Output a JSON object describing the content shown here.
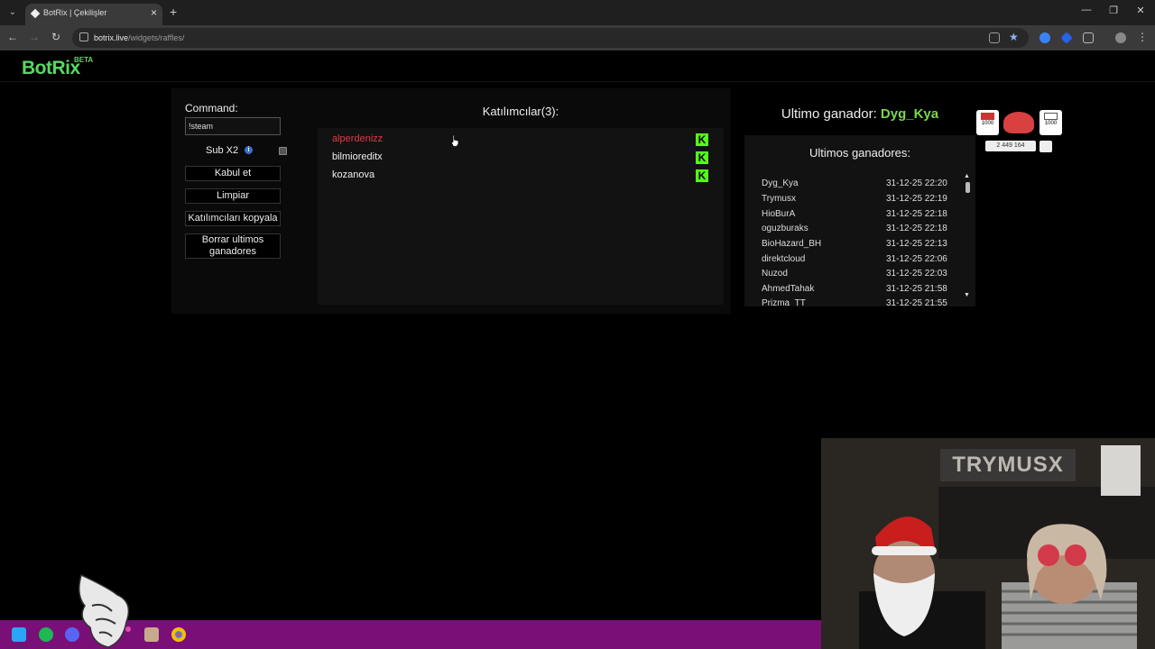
{
  "browser": {
    "tab_title": "BotRix | Çekilişler",
    "url_host": "botrix.live",
    "url_path": "/widgets/raffles/"
  },
  "app": {
    "logo": "BotRix",
    "logo_badge": "BETA"
  },
  "controls": {
    "command_label": "Command:",
    "command_value": "!steam",
    "sub_x2_label": "Sub X2",
    "sub_x2_checked": false,
    "accept_label": "Kabul et",
    "clear_label": "Limpiar",
    "copy_participants_label": "Katılımcıları kopyala",
    "delete_winners_label": "Borrar ultimos ganadores"
  },
  "participants": {
    "title": "Katılımcılar(3):",
    "items": [
      {
        "name": "alperdenizz",
        "platform": "kick-icon",
        "highlight": true
      },
      {
        "name": "bilmioreditx",
        "platform": "kick-icon",
        "highlight": false
      },
      {
        "name": "kozanova",
        "platform": "kick-icon",
        "highlight": false
      }
    ]
  },
  "winners": {
    "last_label": "Ultimo ganador:",
    "last_name": "Dyg_Kya",
    "list_title": "Ultimos ganadores:",
    "items": [
      {
        "name": "Dyg_Kya",
        "date": "31-12-25 22:20"
      },
      {
        "name": "Trymusx",
        "date": "31-12-25 22:19"
      },
      {
        "name": "HioBurA",
        "date": "31-12-25 22:18"
      },
      {
        "name": "oguzburaks",
        "date": "31-12-25 22:18"
      },
      {
        "name": "BioHazard_BH",
        "date": "31-12-25 22:13"
      },
      {
        "name": "direktcloud",
        "date": "31-12-25 22:06"
      },
      {
        "name": "Nuzod",
        "date": "31-12-25 22:03"
      },
      {
        "name": "AhmedTahak",
        "date": "31-12-25 21:58"
      },
      {
        "name": "Prizma_TT",
        "date": "31-12-25 21:55"
      }
    ]
  },
  "overlay": {
    "badge_left": "1000",
    "badge_right": "1000",
    "counter": "2 449 164"
  },
  "webcam": {
    "sign_text": "TRYMUSX"
  },
  "colors": {
    "brand_green": "#59d863",
    "kick_green": "#53fc18",
    "winner_red": "#e23b45",
    "taskbar_purple": "#7a0f77"
  }
}
